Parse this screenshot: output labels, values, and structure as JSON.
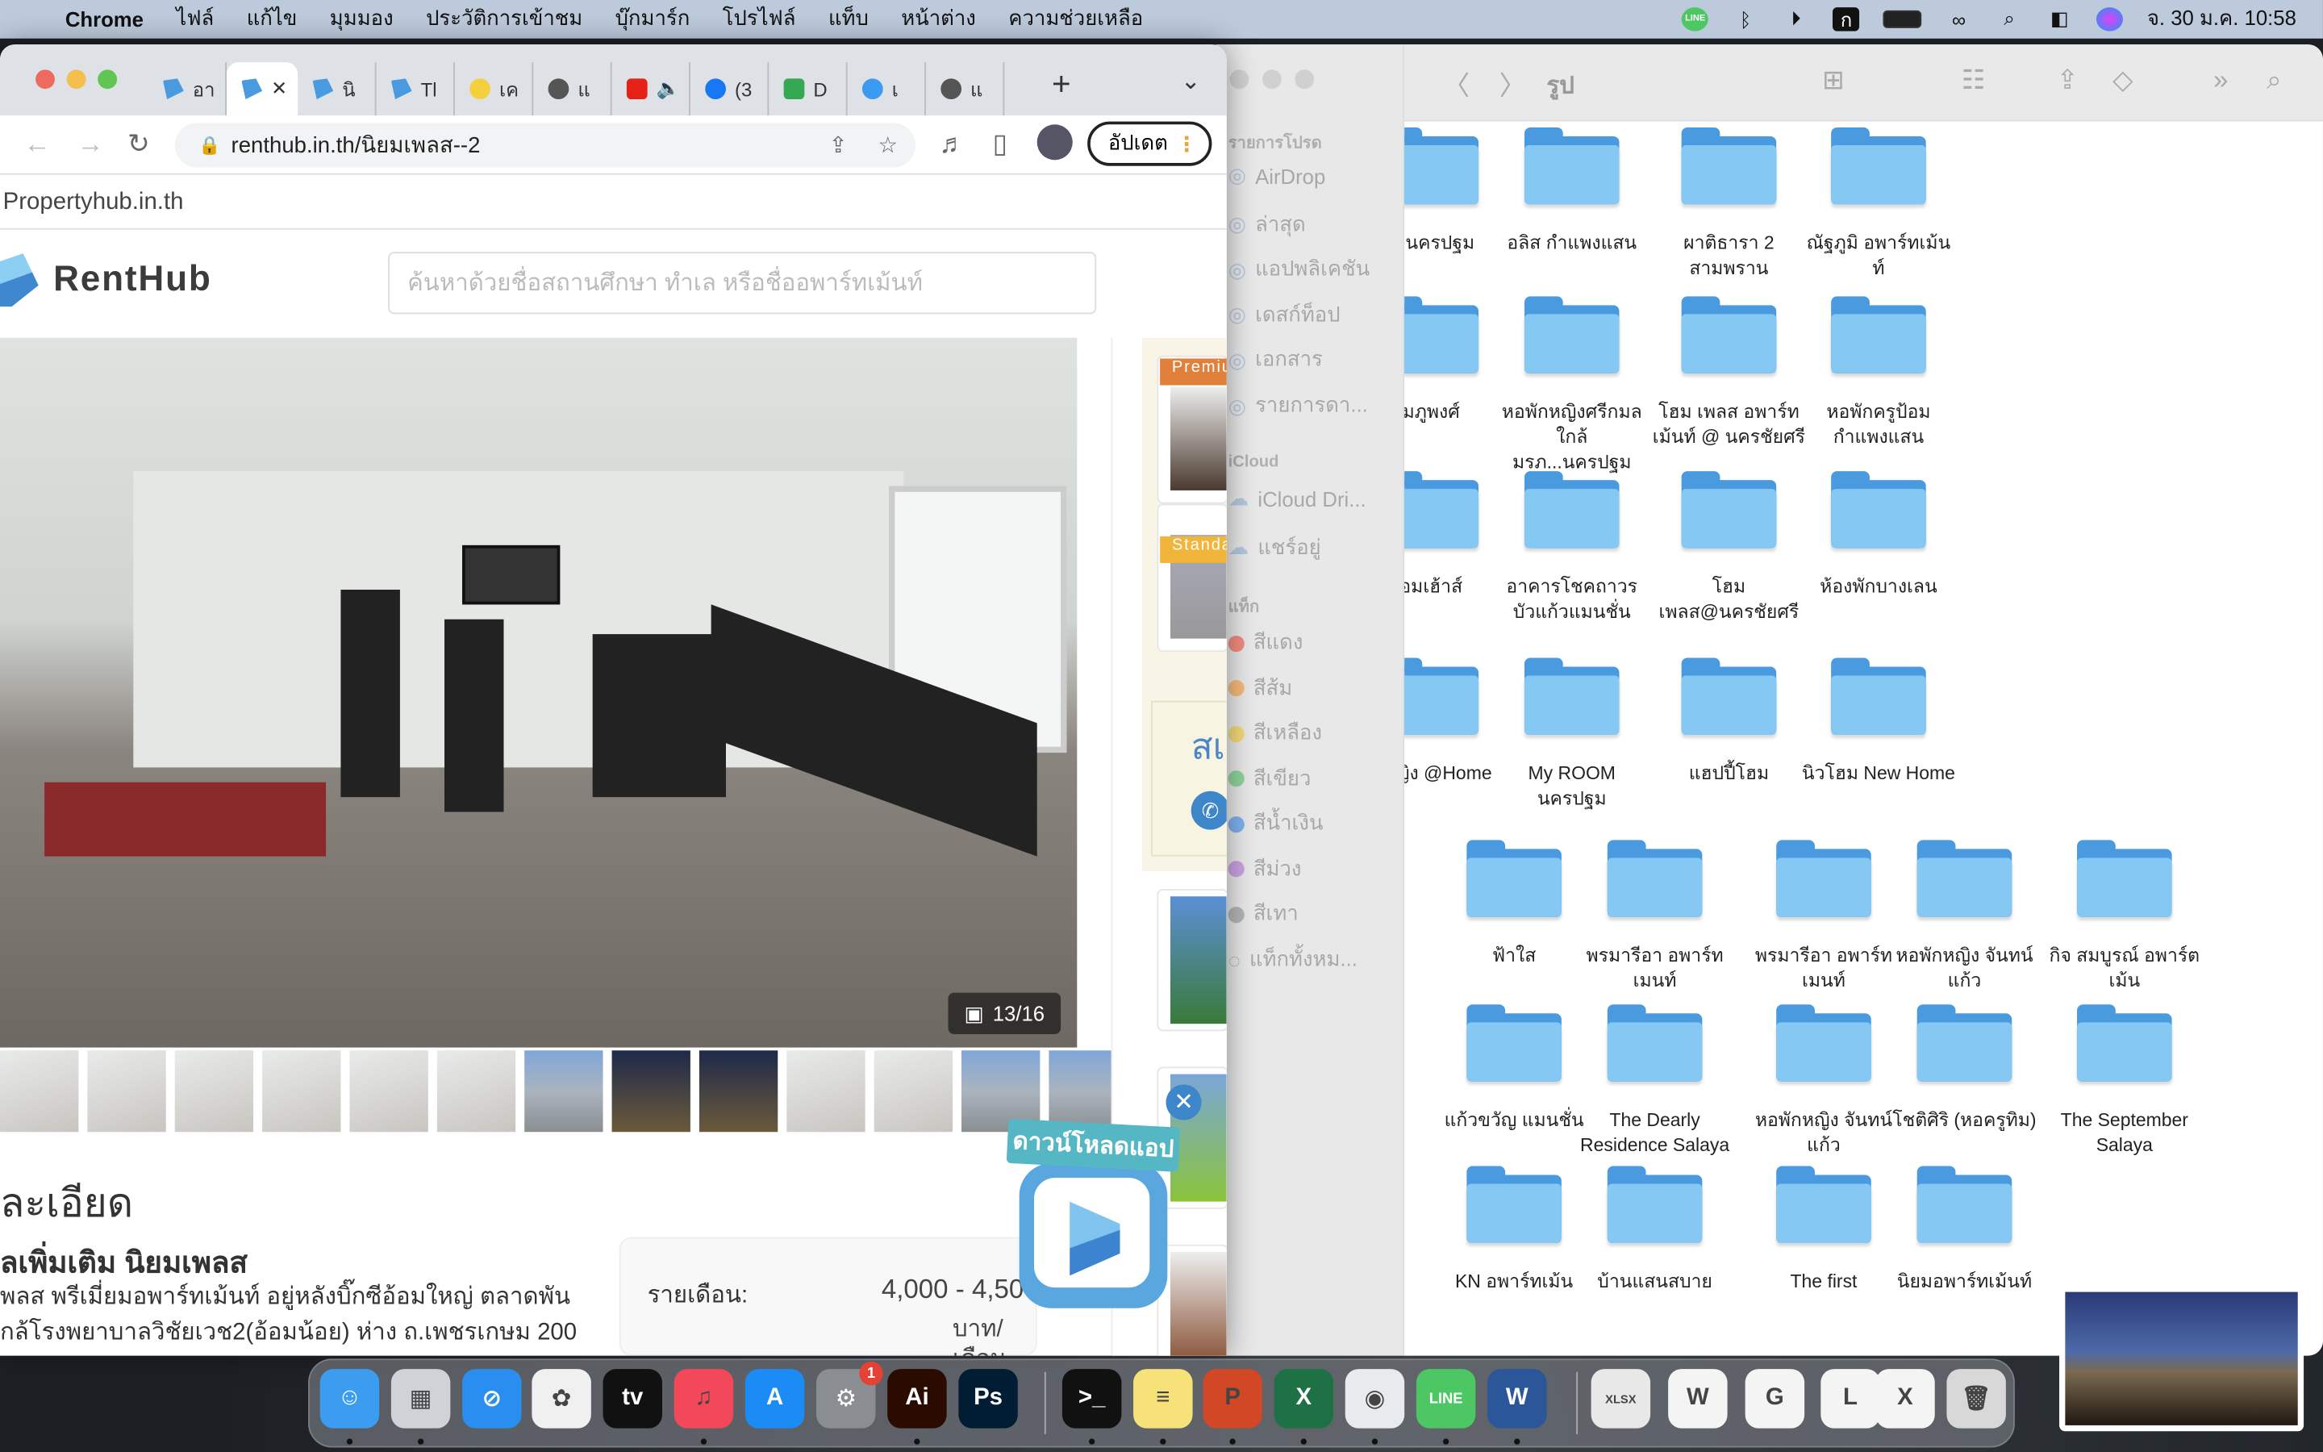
{
  "menubar": {
    "app": "Chrome",
    "items": [
      "ไฟล์",
      "แก้ไข",
      "มุมมอง",
      "ประวัติการเข้าชม",
      "บุ๊กมาร์ก",
      "โปรไฟล์",
      "แท็บ",
      "หน้าต่าง",
      "ความช่วยเหลือ"
    ],
    "status_icons": [
      "line-icon",
      "bluetooth-icon",
      "play-icon",
      "thai-input-icon",
      "battery-icon",
      "link-icon",
      "spotlight-icon",
      "control-center-icon",
      "siri-icon"
    ],
    "line_label": "LINE",
    "input_label": "ก",
    "datetime": "จ. 30 ม.ค.  10:58"
  },
  "browser": {
    "tabs": [
      {
        "icon": "renthub",
        "label": "อา"
      },
      {
        "icon": "renthub",
        "label": "",
        "active": true
      },
      {
        "icon": "renthub",
        "label": "นิ"
      },
      {
        "icon": "renthub",
        "label": "Tl"
      },
      {
        "icon": "emoji",
        "label": "เค"
      },
      {
        "icon": "chrome",
        "label": "แ"
      },
      {
        "icon": "youtube",
        "label": "🔈"
      },
      {
        "icon": "facebook",
        "label": "(3"
      },
      {
        "icon": "sheets",
        "label": "D"
      },
      {
        "icon": "bi",
        "label": "เ"
      },
      {
        "icon": "chrome",
        "label": "แ"
      }
    ],
    "close_tab": "✕",
    "new_tab": "+",
    "tab_menu": "⌄",
    "url": "renthub.in.th/นิยมเพลส--2",
    "update_label": "อัปเดต",
    "colors": {
      "renthub": "#4a9ae0",
      "youtube": "#e62117",
      "facebook": "#1877f2",
      "sheets": "#34a853",
      "bi": "#3b9bf0",
      "chrome": "#555555",
      "emoji": "#f4d03f"
    }
  },
  "page": {
    "topline": "Propertyhub.in.th",
    "logo": "RentHub",
    "search_placeholder": "ค้นหาด้วยชื่อสถานศึกษา ทำเล หรือชื่ออพาร์ทเม้นท์",
    "photo_counter": "13/16",
    "detail_heading": "ละเอียด",
    "sub_heading": "ลเพิ่มเติม นิยมเพลส",
    "desc": [
      "พลส พรีเมี่ยมอพาร์ทเม้นท์ อยู่หลังบิ๊กซีอ้อมใหญ่ ตลาดพัน",
      "กล้โรงพยาบาลวิชัยเวช2(อ้อมน้อย) ห่าง ถ.เพชรเกษม 200"
    ],
    "price_label": "รายเดือน:",
    "price_value": "4,000 - 4,50",
    "price_unit": "บาท/เดือน",
    "ribbons": [
      "Premiu",
      "Standa"
    ],
    "contact_text": "สเ",
    "app_label": "ดาวน์โหลดแอป"
  },
  "finder": {
    "title": "รูป",
    "sidebar": {
      "favorites_header": "รายการโปรด",
      "favorites": [
        "AirDrop",
        "ล่าสุด",
        "แอปพลิเคชัน",
        "เดสก์ท็อป",
        "เอกสาร",
        "รายการดา..."
      ],
      "icloud_header": "iCloud",
      "icloud": [
        "iCloud Dri...",
        "แชร์อยู่"
      ],
      "tags_header": "แท็ก",
      "tags": [
        {
          "label": "สีแดง",
          "color": "#f28b82"
        },
        {
          "label": "สีส้ม",
          "color": "#f5b97a"
        },
        {
          "label": "สีเหลือง",
          "color": "#f2d97a"
        },
        {
          "label": "สีเขียว",
          "color": "#8ed49a"
        },
        {
          "label": "สีน้ำเงิน",
          "color": "#7fb0ee"
        },
        {
          "label": "สีม่วง",
          "color": "#c9a3e0"
        },
        {
          "label": "สีเทา",
          "color": "#b5b5b5"
        }
      ],
      "all_tags": "แท็กทั้งหม..."
    },
    "folders_upper": [
      "ข นครปฐม",
      "อลิส กำแพงแสน",
      "ผาติธารา 2 สามพราน",
      "ณัฐภูมิ อพาร์ทเม้นท์",
      "มภูพงศ์",
      "หอพักหญิงศรีกมล ใกล้ มรภ...นครปฐม",
      "โฮม เพลส อพาร์ทเม้นท์ @ นครชัยศรี",
      "หอพักครูป้อม กำแพงแสน",
      "อมเฮ้าส์",
      "อาคารโชคถาวร บัวแก้วแมนชั่น",
      "โฮม เพลส@นครชัยศรี",
      "ห้องพักบางเลน",
      "กหญิง @Home",
      "My ROOM นครปฐม",
      "แฮปปี้โฮม",
      "นิวโฮม New Home"
    ],
    "folders_lower": [
      "ฟ้าใส",
      "พรมารีอา อพาร์ทเมนท์",
      "พรมารีอา อพาร์ทเมนท์",
      "หอพักหญิง จันทน์แก้ว",
      "กิจ สมบูรณ์ อพาร์ตเม้น",
      "แก้วขวัญ แมนชั่น",
      "The Dearly Residence Salaya",
      "หอพักหญิง จันทน์แก้ว",
      "โชติศิริ (หอครูทิม)",
      "The September Salaya",
      "KN อพาร์ทเม้น",
      "บ้านแสนสบาย",
      "The first",
      "นิยมอพาร์ทเม้นท์"
    ]
  },
  "dock": {
    "apps": [
      {
        "name": "finder",
        "label": "☺",
        "color": "#3c9cf0"
      },
      {
        "name": "launchpad",
        "label": "▦",
        "color": "#cfd3d8"
      },
      {
        "name": "safari",
        "label": "⊘",
        "color": "#2a8ef0"
      },
      {
        "name": "photos",
        "label": "✿",
        "color": "#f0f0f0"
      },
      {
        "name": "apple-tv",
        "label": "tv",
        "color": "#111111"
      },
      {
        "name": "music",
        "label": "♫",
        "color": "#f3485a"
      },
      {
        "name": "app-store",
        "label": "A",
        "color": "#1b8cf5"
      },
      {
        "name": "system-preferences",
        "label": "⚙",
        "color": "#8a8d92",
        "badge": "1"
      },
      {
        "name": "illustrator",
        "label": "Ai",
        "color": "#2b0a00"
      },
      {
        "name": "photoshop",
        "label": "Ps",
        "color": "#001d34"
      },
      {
        "name": "terminal",
        "label": ">_",
        "color": "#111111"
      },
      {
        "name": "notes",
        "label": "≡",
        "color": "#f7e27a"
      },
      {
        "name": "powerpoint",
        "label": "P",
        "color": "#d24726"
      },
      {
        "name": "excel",
        "label": "X",
        "color": "#1e7145"
      },
      {
        "name": "chrome",
        "label": "◉",
        "color": "#e8eaed"
      },
      {
        "name": "line",
        "label": "LINE",
        "color": "#4cc764"
      },
      {
        "name": "word",
        "label": "W",
        "color": "#2b579a"
      },
      {
        "name": "xlsx-file",
        "label": "XLSX",
        "color": "#e8e8e8"
      },
      {
        "name": "word-window",
        "label": "W",
        "color": "#f4f4f4"
      },
      {
        "name": "chrome-window",
        "label": "G",
        "color": "#f4f4f4"
      },
      {
        "name": "line-window",
        "label": "L",
        "color": "#f4f4f4"
      },
      {
        "name": "excel-window",
        "label": "X",
        "color": "#f4f4f4"
      },
      {
        "name": "trash",
        "label": "🗑",
        "color": "#d8d8d8"
      }
    ]
  }
}
